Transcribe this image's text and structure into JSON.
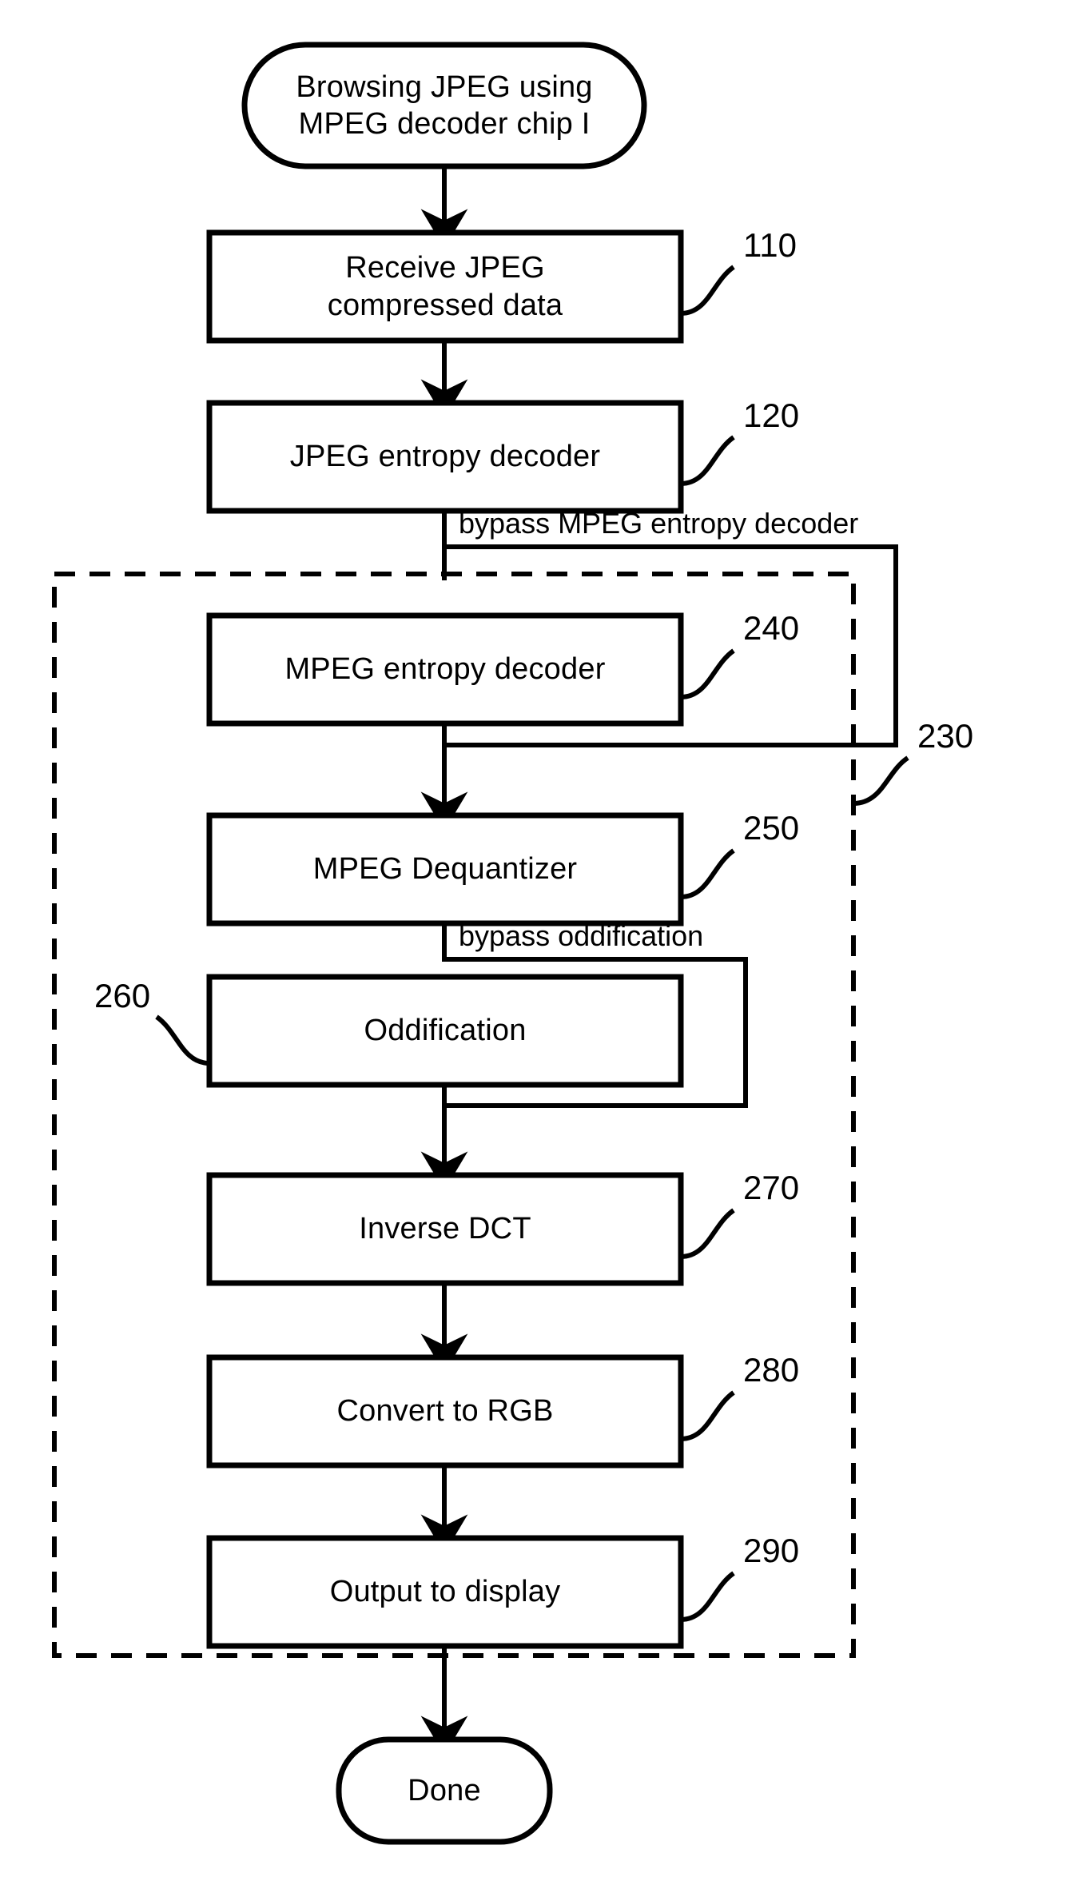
{
  "figure": {
    "type": "flowchart",
    "orientation": "vertical",
    "background_color": "#ffffff",
    "line_color": "#000000"
  },
  "nodes": {
    "start": {
      "shape": "rounded-terminal",
      "line1": "Browsing JPEG using",
      "line2": "MPEG decoder chip I"
    },
    "receive": {
      "shape": "rectangle",
      "line1": "Receive JPEG",
      "line2": "compressed data",
      "ref": "110"
    },
    "jpeg_entropy_decoder": {
      "shape": "rectangle",
      "line1": "JPEG entropy decoder",
      "ref": "120"
    },
    "mpeg_entropy_decoder": {
      "shape": "rectangle",
      "line1": "MPEG entropy decoder",
      "ref": "240"
    },
    "mpeg_dequantizer": {
      "shape": "rectangle",
      "line1": "MPEG Dequantizer",
      "ref": "250"
    },
    "oddification": {
      "shape": "rectangle",
      "line1": "Oddification",
      "ref": "260"
    },
    "inverse_dct": {
      "shape": "rectangle",
      "line1": "Inverse DCT",
      "ref": "270"
    },
    "convert_to_rgb": {
      "shape": "rectangle",
      "line1": "Convert to RGB",
      "ref": "280"
    },
    "output_to_display": {
      "shape": "rectangle",
      "line1": "Output to display",
      "ref": "290"
    },
    "done": {
      "shape": "rounded-terminal",
      "line1": "Done"
    }
  },
  "group": {
    "style": "dashed-border",
    "ref": "230"
  },
  "edge_labels": {
    "bypass_mpeg_entropy_decoder": "bypass MPEG entropy decoder",
    "bypass_oddification": "bypass oddification"
  }
}
